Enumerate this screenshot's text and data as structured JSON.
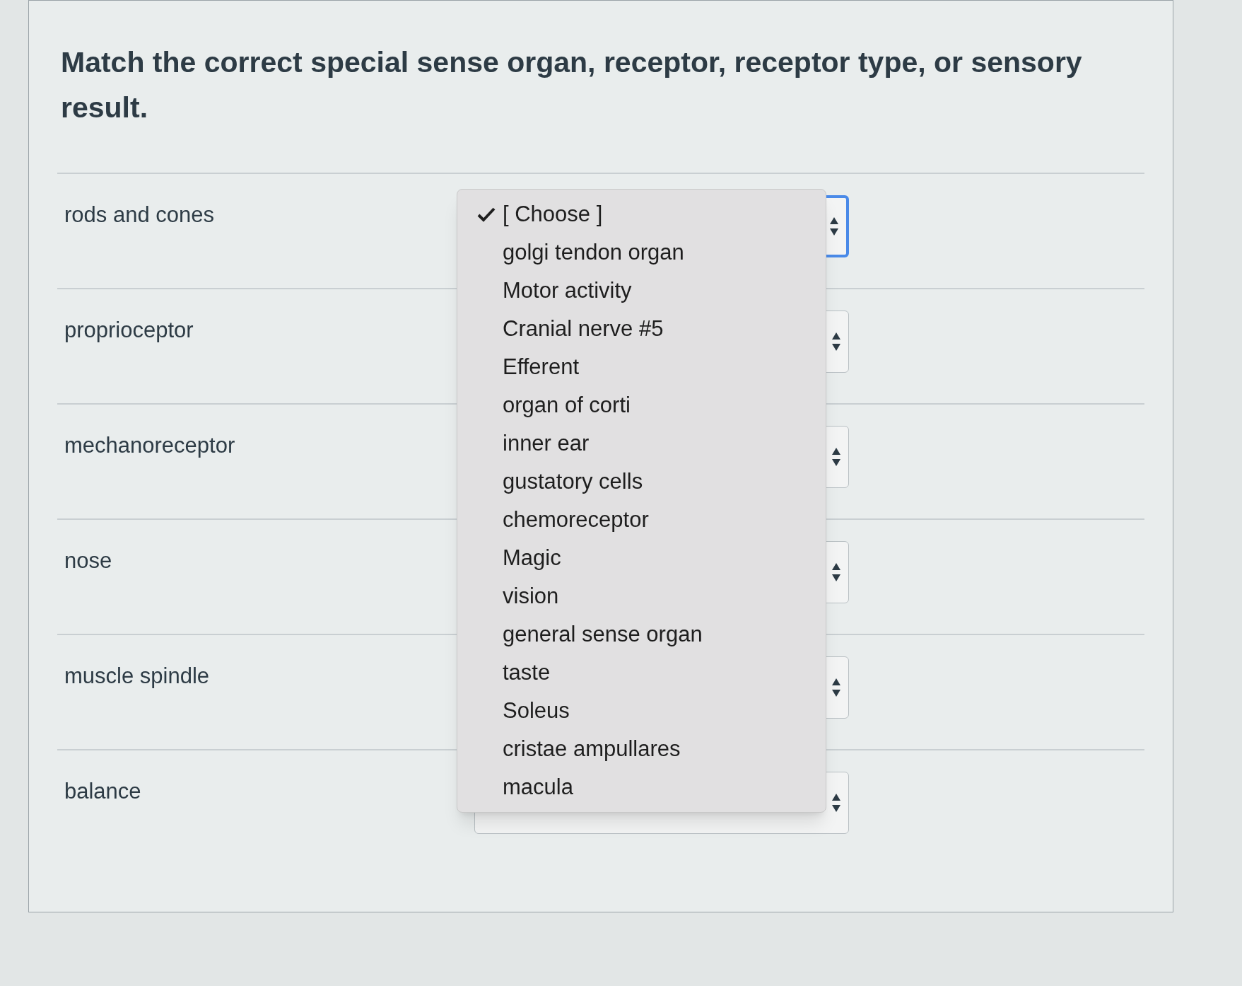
{
  "question": {
    "title": "Match the correct special sense organ, receptor, receptor type, or sensory result."
  },
  "rows": [
    {
      "label": "rods and cones",
      "focused": true
    },
    {
      "label": "proprioceptor",
      "focused": false
    },
    {
      "label": "mechanoreceptor",
      "focused": false
    },
    {
      "label": "nose",
      "focused": false
    },
    {
      "label": "muscle spindle",
      "focused": false
    },
    {
      "label": "balance",
      "focused": false
    }
  ],
  "menu": {
    "options": [
      {
        "label": "[ Choose ]",
        "selected": true
      },
      {
        "label": "golgi tendon organ",
        "selected": false
      },
      {
        "label": "Motor activity",
        "selected": false
      },
      {
        "label": "Cranial nerve #5",
        "selected": false
      },
      {
        "label": "Efferent",
        "selected": false
      },
      {
        "label": "organ of corti",
        "selected": false
      },
      {
        "label": "inner ear",
        "selected": false
      },
      {
        "label": "gustatory cells",
        "selected": false
      },
      {
        "label": "chemoreceptor",
        "selected": false
      },
      {
        "label": "Magic",
        "selected": false
      },
      {
        "label": "vision",
        "selected": false
      },
      {
        "label": "general sense organ",
        "selected": false
      },
      {
        "label": "taste",
        "selected": false
      },
      {
        "label": "Soleus",
        "selected": false
      },
      {
        "label": "cristae ampullares",
        "selected": false
      },
      {
        "label": "macula",
        "selected": false
      }
    ]
  }
}
